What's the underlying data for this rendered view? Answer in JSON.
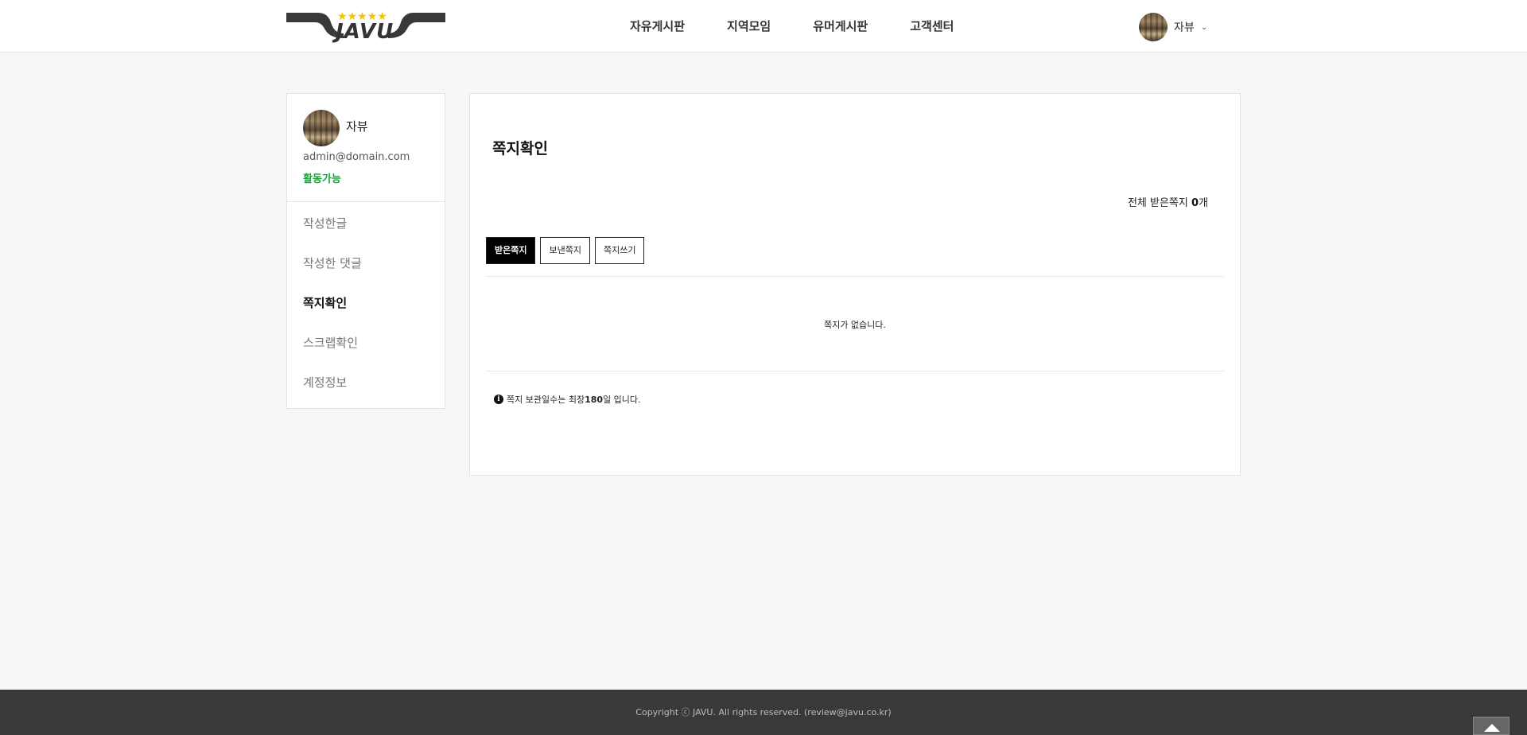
{
  "brand": {
    "logo_text": "JAVU",
    "stars": "★★★★★",
    "accent": "#f5c400"
  },
  "nav": {
    "items": [
      {
        "label": "자유게시판"
      },
      {
        "label": "지역모임"
      },
      {
        "label": "유머게시판"
      },
      {
        "label": "고객센터"
      }
    ]
  },
  "user": {
    "name": "자뷰",
    "chevron": "⌄"
  },
  "profile": {
    "name": "자뷰",
    "email": "admin@domain.com",
    "status": "활동가능",
    "status_color": "#1aa33a"
  },
  "sidebar": {
    "items": [
      {
        "label": "작성한글",
        "active": false
      },
      {
        "label": "작성한 댓글",
        "active": false
      },
      {
        "label": "쪽지확인",
        "active": true
      },
      {
        "label": "스크랩확인",
        "active": false
      },
      {
        "label": "계정정보",
        "active": false
      }
    ]
  },
  "main": {
    "title": "쪽지확인",
    "total_prefix": "전체 받은쪽지 ",
    "total_count": "0",
    "total_suffix": "개",
    "tabs": [
      {
        "label": "받은쪽지",
        "active": true
      },
      {
        "label": "보낸쪽지",
        "active": false
      },
      {
        "label": "쪽지쓰기",
        "active": false
      }
    ],
    "empty_message": "쪽지가 없습니다.",
    "notice_prefix": "쪽지 보관일수는 최장 ",
    "notice_days": "180",
    "notice_suffix": "일 입니다.",
    "info_icon": "i"
  },
  "footer": {
    "copyright": "Copyright ⓒ JAVU. All rights reserved. (review@javu.co.kr)"
  }
}
